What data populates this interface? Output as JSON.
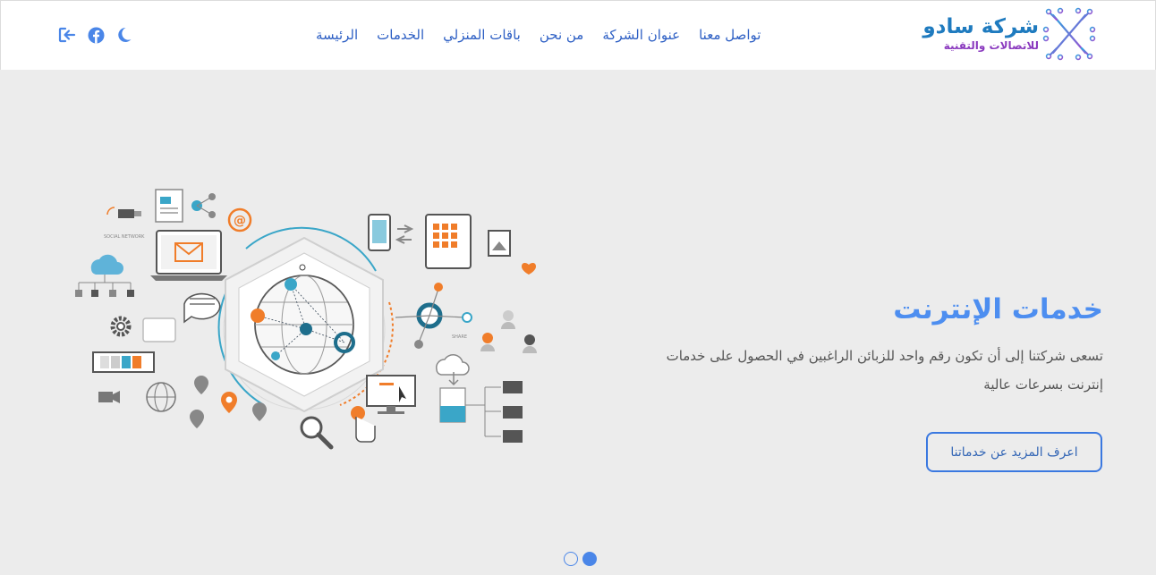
{
  "header": {
    "logo": {
      "main": "شركة سادو",
      "sub": "للاتصالات والتقنية"
    },
    "nav": [
      {
        "label": "الرئيسة"
      },
      {
        "label": "الخدمات"
      },
      {
        "label": "باقات المنزلي"
      },
      {
        "label": "من نحن"
      },
      {
        "label": "عنوان الشركة"
      },
      {
        "label": "تواصل معنا"
      }
    ],
    "icons": [
      "logout-icon",
      "facebook-icon",
      "moon-icon"
    ]
  },
  "hero": {
    "title": "خدمات الإنترنت",
    "description": "تسعى شركتنا إلى أن تكون رقم واحد للزبائن الراغبين في الحصول على خدمات إنترنت بسرعات عالية",
    "button_label": "اعرف المزيد عن خدماتنا",
    "illustration_labels": {
      "social": "SOCIAL NETWORK",
      "share": "SHARE"
    }
  },
  "carousel": {
    "slides": 2,
    "active": 2
  },
  "colors": {
    "accent": "#4a86e8",
    "nav": "#2d5fc4",
    "hero_bg": "#ececec",
    "orange": "#f07d2a",
    "teal": "#1e6e8c"
  }
}
